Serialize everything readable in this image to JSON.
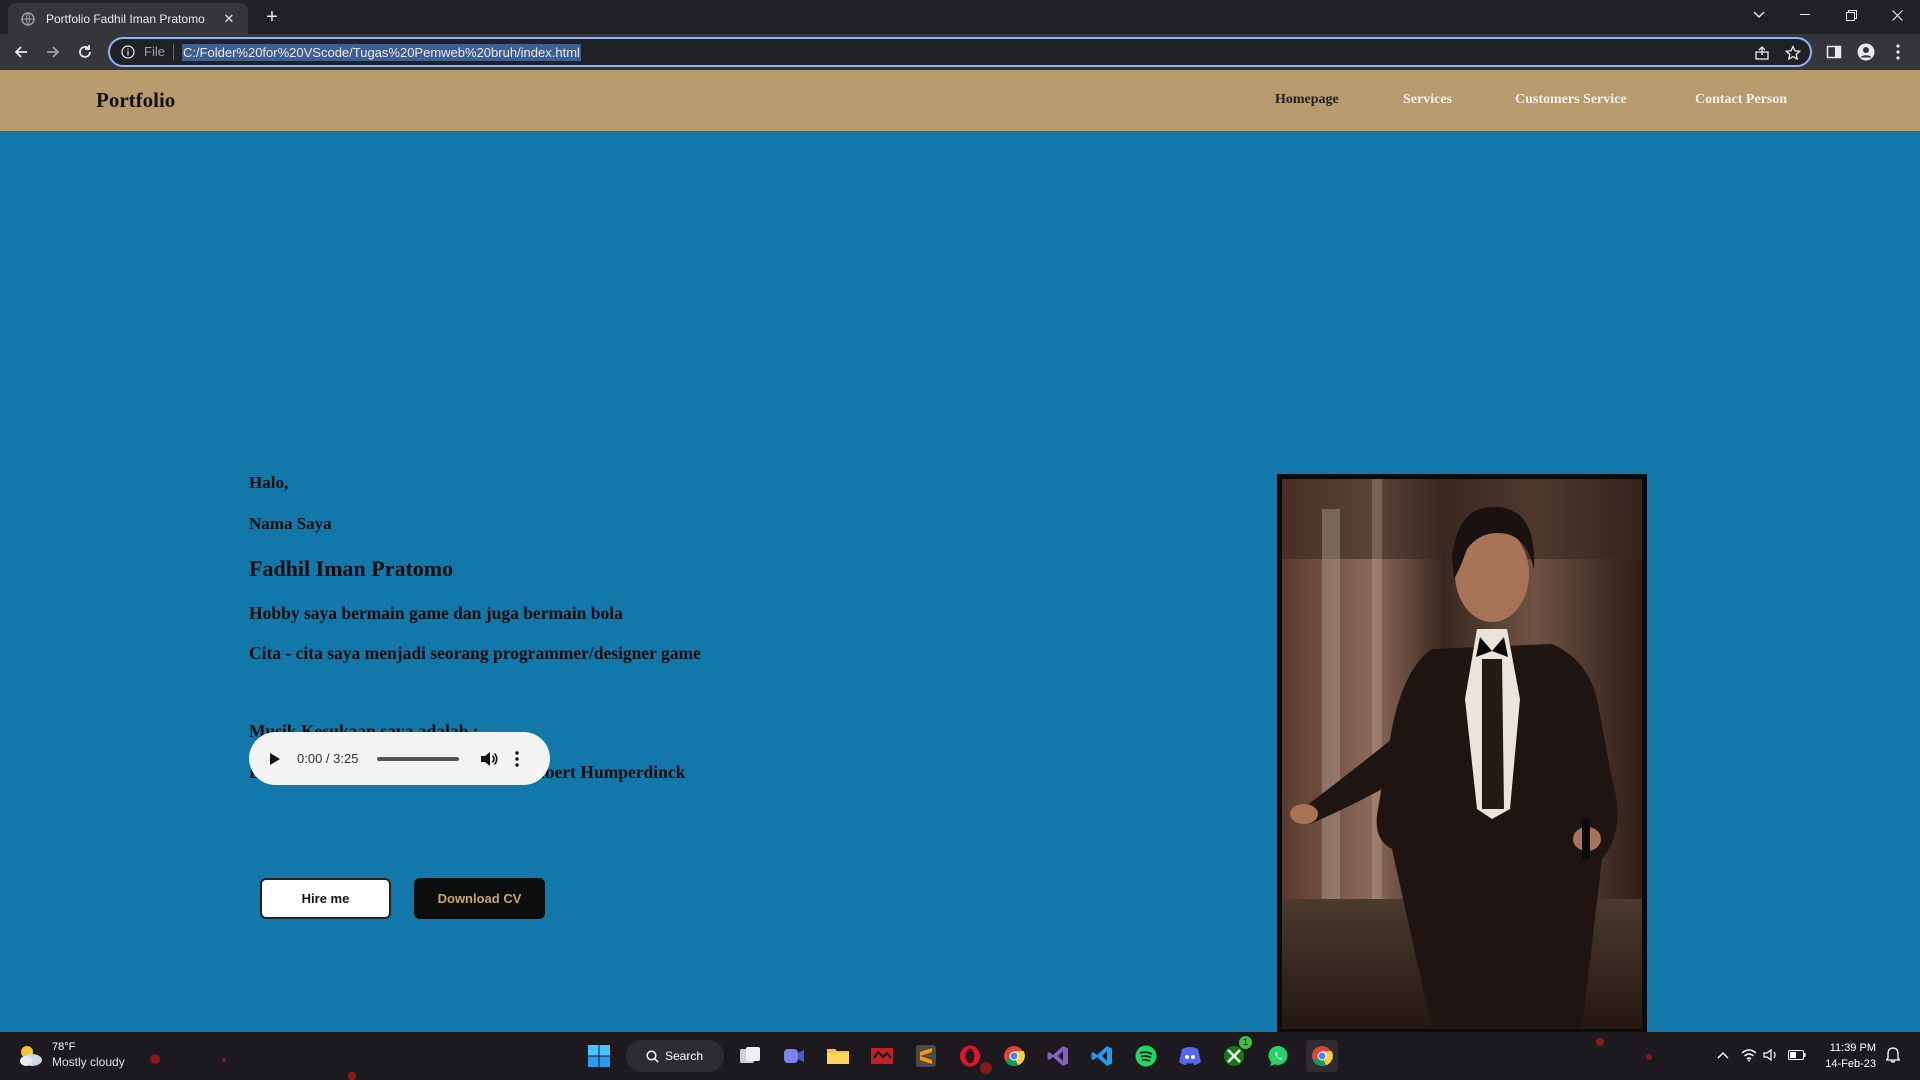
{
  "browser": {
    "tab_title": "Portfolio Fadhil Iman Pratomo",
    "address_scheme": "File",
    "address_url": "C:/Folder%20for%20VScode/Tugas%20Pemweb%20bruh/index.html"
  },
  "site": {
    "brand": "Portfolio",
    "nav": [
      "Homepage",
      "Services",
      "Customers Service",
      "Contact Person"
    ],
    "greeting": "Halo,",
    "intro": "Nama Saya",
    "name": "Fadhil Iman Pratomo",
    "hobby": "Hobby saya bermain game dan juga bermain bola",
    "ambition": "Cita - cita saya menjadi seorang programmer/designer game",
    "music_label": "Musik Kesukaan saya adalah :",
    "song": "Love Me With All Of Your Love - Engelbert Humperdinck",
    "audio_time": "0:00 / 3:25",
    "hire_button": "Hire me",
    "cv_button": "Download CV"
  },
  "taskbar": {
    "temperature": "78°F",
    "weather": "Mostly cloudy",
    "search_label": "Search",
    "time": "11:39 PM",
    "date": "14-Feb-23",
    "xbox_badge": "1"
  }
}
